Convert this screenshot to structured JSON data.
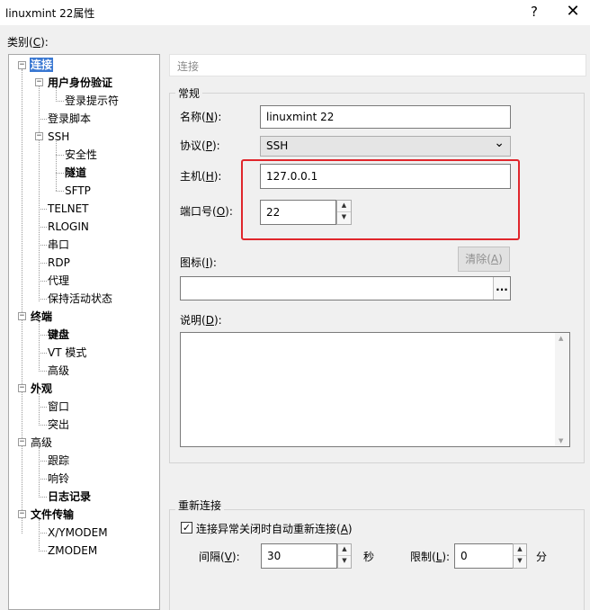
{
  "window": {
    "title": "linuxmint 22属性",
    "help_label": "?",
    "close_label": "✕"
  },
  "category_label_pre": "类别(",
  "category_label_key": "C",
  "category_label_post": "):",
  "tree": {
    "connection": "连接",
    "user_auth": "用户身份验证",
    "login_prompt": "登录提示符",
    "login_script": "登录脚本",
    "ssh": "SSH",
    "security": "安全性",
    "tunnel": "隧道",
    "sftp": "SFTP",
    "telnet": "TELNET",
    "rlogin": "RLOGIN",
    "serial": "串口",
    "rdp": "RDP",
    "proxy": "代理",
    "keepalive": "保持活动状态",
    "terminal": "终端",
    "keyboard": "键盘",
    "vt_mode": "VT 模式",
    "advanced1": "高级",
    "appearance": "外观",
    "window": "窗口",
    "highlight": "突出",
    "advanced2": "高级",
    "trace": "跟踪",
    "bell": "响铃",
    "logging": "日志记录",
    "file_transfer": "文件传输",
    "xymodem": "X/YMODEM",
    "zmodem": "ZMODEM",
    "expander_minus": "−"
  },
  "header": "连接",
  "general": {
    "group_title": "常规",
    "name_label_pre": "名称(",
    "name_label_key": "N",
    "name_label_post": "):",
    "name_value": "linuxmint 22",
    "protocol_label_pre": "协议(",
    "protocol_label_key": "P",
    "protocol_label_post": "):",
    "protocol_value": "SSH",
    "host_label_pre": "主机(",
    "host_label_key": "H",
    "host_label_post": "):",
    "host_value": "127.0.0.1",
    "port_label_pre": "端口号(",
    "port_label_key": "O",
    "port_label_post": "):",
    "port_value": "22",
    "icon_label_pre": "图标(",
    "icon_label_key": "I",
    "icon_label_post": "):",
    "clear_label_pre": "清除(",
    "clear_label_key": "A",
    "clear_label_post": ")",
    "browse_label": "...",
    "desc_label_pre": "说明(",
    "desc_label_key": "D",
    "desc_label_post": "):"
  },
  "reconnect": {
    "group_title": "重新连接",
    "checkbox_checked": true,
    "checkbox_mark": "✓",
    "checkbox_label_pre": "连接异常关闭时自动重新连接(",
    "checkbox_label_key": "A",
    "checkbox_label_post": ")",
    "interval_label_pre": "间隔(",
    "interval_label_key": "V",
    "interval_label_post": "):",
    "interval_value": "30",
    "seconds_unit": "秒",
    "limit_label_pre": "限制(",
    "limit_label_key": "L",
    "limit_label_post": "):",
    "limit_value": "0",
    "minutes_unit": "分"
  },
  "icons": {
    "up": "▲",
    "down": "▼",
    "chevron": "⌄"
  },
  "colors": {
    "selection": "#3a78d2",
    "annotation_box": "#e0262c"
  }
}
